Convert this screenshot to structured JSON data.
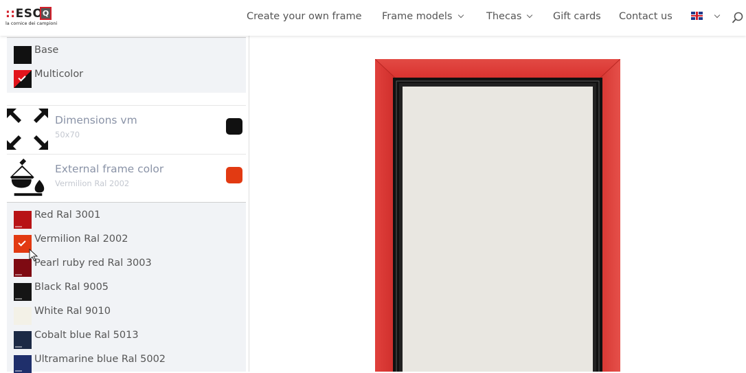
{
  "header": {
    "logo": {
      "name_prefix": "::",
      "name": "ESO",
      "box_letter": "Q",
      "tagline": "la cornice dei campioni"
    },
    "nav": [
      {
        "label": "Create your own frame",
        "has_dropdown": false
      },
      {
        "label": "Frame models",
        "has_dropdown": true
      },
      {
        "label": "Thecas",
        "has_dropdown": true
      },
      {
        "label": "Gift cards",
        "has_dropdown": false
      },
      {
        "label": "Contact us",
        "has_dropdown": false
      }
    ],
    "language_flag": "uk-flag-icon",
    "search_icon": "search-icon"
  },
  "style_options": [
    {
      "label": "Base",
      "color": "#111111",
      "selected": false
    },
    {
      "label": "Multicolor",
      "color": "multi",
      "selected": true
    }
  ],
  "dimensions": {
    "title": "Dimensions vm",
    "value": "50x70",
    "icon": "expand-arrows-icon",
    "chip_color": "#111111"
  },
  "external_color": {
    "title": "External frame color",
    "value": "Vermilion Ral 2002",
    "icon": "paint-bucket-icon",
    "chip_color": "#e23a12"
  },
  "colors": [
    {
      "label": "Red Ral 3001",
      "color": "#b81316",
      "selected": false
    },
    {
      "label": "Vermilion Ral 2002",
      "color": "#e23a12",
      "selected": true
    },
    {
      "label": "Pearl ruby red Ral 3003",
      "color": "#7e0a12",
      "selected": false
    },
    {
      "label": "Black Ral 9005",
      "color": "#151515",
      "selected": false
    },
    {
      "label": "White Ral 9010",
      "color": "#f3f1e7",
      "selected": false
    },
    {
      "label": "Cobalt blue Ral 5013",
      "color": "#1c2a45",
      "selected": false
    },
    {
      "label": "Ultramarine blue Ral 5002",
      "color": "#1f2f6b",
      "selected": false
    }
  ],
  "preview": {
    "outer_color": "#e03a36",
    "inner_color": "#111111",
    "mat_color": "#e9e7e1"
  }
}
